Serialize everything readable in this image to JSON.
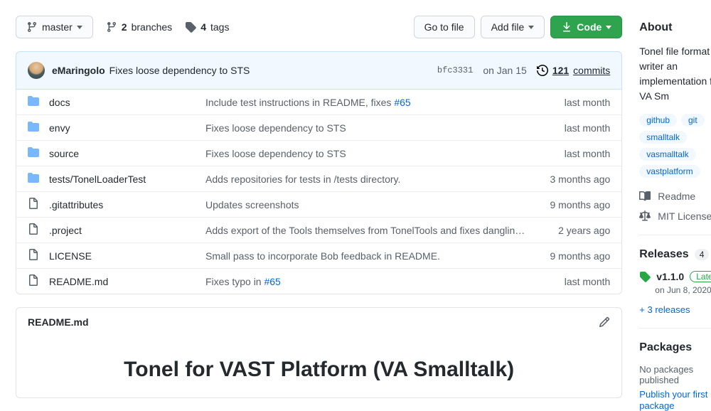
{
  "branch_button": "master",
  "branches": {
    "count": "2",
    "label": "branches"
  },
  "tags": {
    "count": "4",
    "label": "tags"
  },
  "go_to_file": "Go to file",
  "add_file": "Add file",
  "code": "Code",
  "commit_bar": {
    "author": "eMaringolo",
    "message": "Fixes loose dependency to STS",
    "hash": "bfc3331",
    "date": "on Jan 15",
    "commit_count": "121",
    "commit_label": "commits"
  },
  "files": [
    {
      "type": "dir",
      "name": "docs",
      "msg_pre": "Include test instructions in README, fixes ",
      "issue": "#65",
      "msg_post": "",
      "date": "last month"
    },
    {
      "type": "dir",
      "name": "envy",
      "msg_pre": "Fixes loose dependency to STS",
      "issue": "",
      "msg_post": "",
      "date": "last month"
    },
    {
      "type": "dir",
      "name": "source",
      "msg_pre": "Fixes loose dependency to STS",
      "issue": "",
      "msg_post": "",
      "date": "last month"
    },
    {
      "type": "dir",
      "name": "tests/TonelLoaderTest",
      "msg_pre": "Adds repositories for tests in /tests directory.",
      "issue": "",
      "msg_post": "",
      "date": "3 months ago"
    },
    {
      "type": "file",
      "name": ".gitattributes",
      "msg_pre": "Updates screenshots",
      "issue": "",
      "msg_post": "",
      "date": "9 months ago"
    },
    {
      "type": "file",
      "name": ".project",
      "msg_pre": "Adds export of the Tools themselves from TonelTools and fixes danglin…",
      "issue": "",
      "msg_post": "",
      "date": "2 years ago"
    },
    {
      "type": "file",
      "name": "LICENSE",
      "msg_pre": "Small pass to incorporate Bob feedback in README.",
      "issue": "",
      "msg_post": "",
      "date": "9 months ago"
    },
    {
      "type": "file",
      "name": "README.md",
      "msg_pre": "Fixes typo in ",
      "issue": "#65",
      "msg_post": "",
      "date": "last month"
    }
  ],
  "readme": {
    "filename": "README.md",
    "heading": "Tonel for VAST Platform (VA Smalltalk)"
  },
  "sidebar": {
    "about_title": "About",
    "description": "Tonel file format writer an implementation for VA Sm",
    "topics": [
      "github",
      "git",
      "smalltalk",
      "vasmalltalk",
      "vastplatform"
    ],
    "readme_label": "Readme",
    "license_label": "MIT License",
    "releases_title": "Releases",
    "releases_count": "4",
    "release_version": "v1.1.0",
    "latest_label": "Latest",
    "release_date": "on Jun 8, 2020",
    "more_releases": "+ 3 releases",
    "packages_title": "Packages",
    "no_packages": "No packages published",
    "publish_first": "Publish your first package"
  }
}
